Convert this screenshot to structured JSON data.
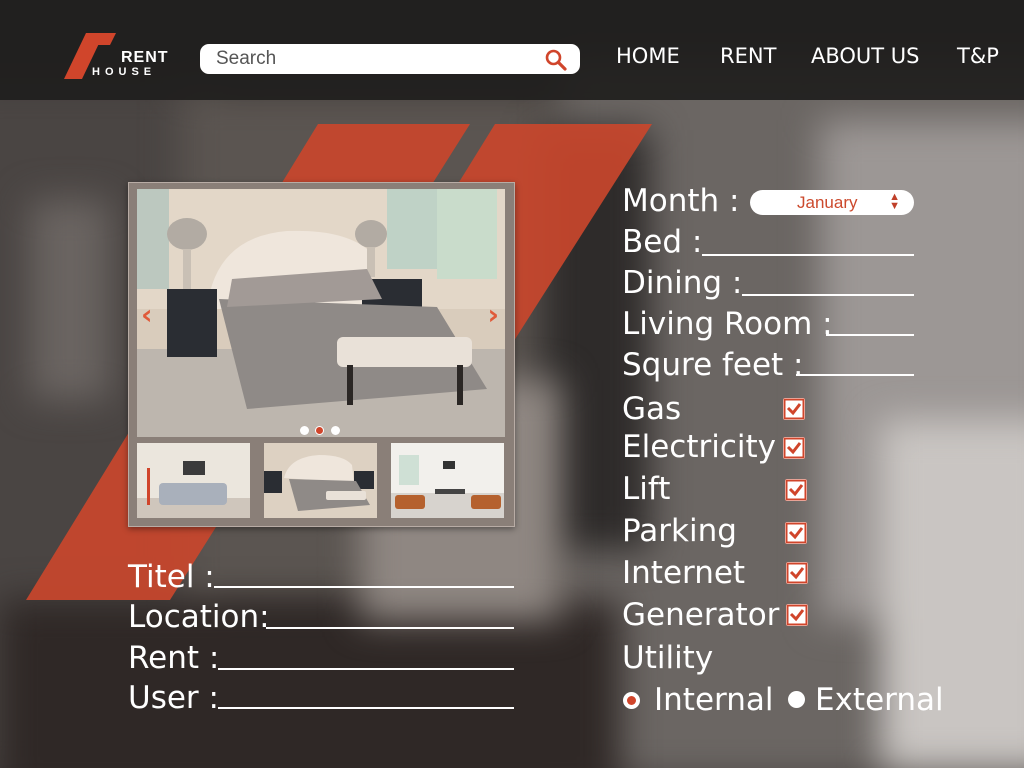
{
  "brand": {
    "line1": "RENT",
    "line2": "HOUSE",
    "accent": "#d0452b"
  },
  "search": {
    "placeholder": "Search"
  },
  "nav": {
    "items": [
      "HOME",
      "RENT",
      "ABOUT US",
      "T&P"
    ]
  },
  "form": {
    "month_label": "Month :",
    "month_value": "January",
    "bed_label": "Bed :",
    "dining_label": "Dining :",
    "living_label": "Living Room :",
    "sqft_label": "Squre feet :",
    "title_label": "Titel :",
    "location_label": "Location:",
    "rent_label": "Rent :",
    "user_label": "User :"
  },
  "amenities": [
    {
      "label": "Gas",
      "checked": true
    },
    {
      "label": "Electricity",
      "checked": true
    },
    {
      "label": "Lift",
      "checked": true
    },
    {
      "label": "Parking",
      "checked": true
    },
    {
      "label": "Internet",
      "checked": true
    },
    {
      "label": "Generator",
      "checked": true
    }
  ],
  "utility": {
    "label": "Utility",
    "options": [
      {
        "label": "Internal",
        "selected": true
      },
      {
        "label": "External",
        "selected": false
      }
    ]
  },
  "gallery": {
    "carousel_index": 2,
    "carousel_count": 3,
    "prev_icon": "chevron-left-icon",
    "next_icon": "chevron-right-icon"
  }
}
